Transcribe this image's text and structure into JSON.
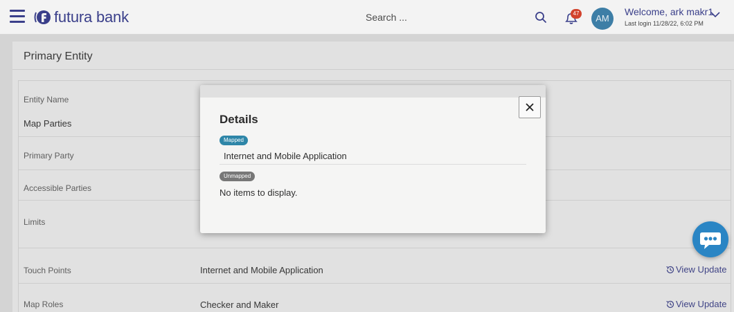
{
  "header": {
    "brand": "futura bank",
    "search_placeholder": "Search ...",
    "notification_count": "47",
    "avatar_initials": "AM",
    "welcome": "Welcome, ark makr1",
    "last_login": "Last login 11/28/22, 6:02 PM",
    "icons": [
      "hamburger-icon",
      "bank-logo",
      "search-icon",
      "bell-icon",
      "chevron-down-icon"
    ]
  },
  "page": {
    "title": "Primary Entity",
    "rows": [
      {
        "label": "Entity Name",
        "value": "Map Parties"
      },
      {
        "label": "Primary Party",
        "value": ""
      },
      {
        "label": "Accessible Parties",
        "value": ""
      },
      {
        "label": "Limits",
        "value": ""
      },
      {
        "label": "Touch Points",
        "value": "Internet and Mobile Application",
        "action": "View Update"
      },
      {
        "label": "Map Roles",
        "value": "Checker and Maker",
        "action": "View Update"
      }
    ]
  },
  "modal": {
    "title": "Details",
    "mapped_label": "Mapped",
    "mapped_items": [
      "Internet and Mobile Application"
    ],
    "unmapped_label": "Unmapped",
    "unmapped_empty_text": "No items to display."
  },
  "colors": {
    "brand": "#3a3f8a",
    "mapped_badge": "#2e86a8",
    "unmapped_badge": "#777777",
    "notification": "#d2432d",
    "chat": "#2a85c4"
  }
}
